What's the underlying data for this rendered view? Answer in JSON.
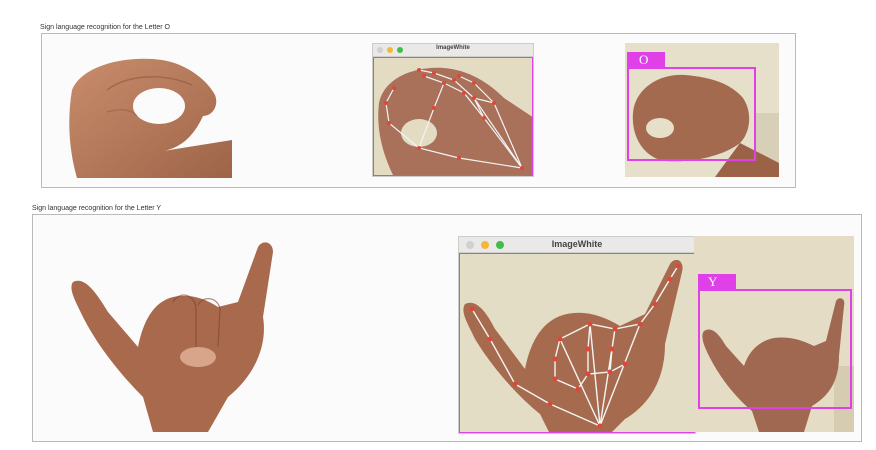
{
  "rows": [
    {
      "caption": "Sign language recognition for the Letter O",
      "window_title": "ImageWhite",
      "predicted_letter": "O"
    },
    {
      "caption": "Sign language recognition for the Letter Y",
      "window_title": "ImageWhite",
      "predicted_letter": "Y"
    }
  ],
  "colors": {
    "window_close": "#d0d0d0",
    "window_minimize": "#f0b93a",
    "window_maximize": "#3fbf4a",
    "bounding_box": "#e040e8",
    "landmark_point": "#e0463a",
    "skeleton_line": "#f4f4f4"
  }
}
